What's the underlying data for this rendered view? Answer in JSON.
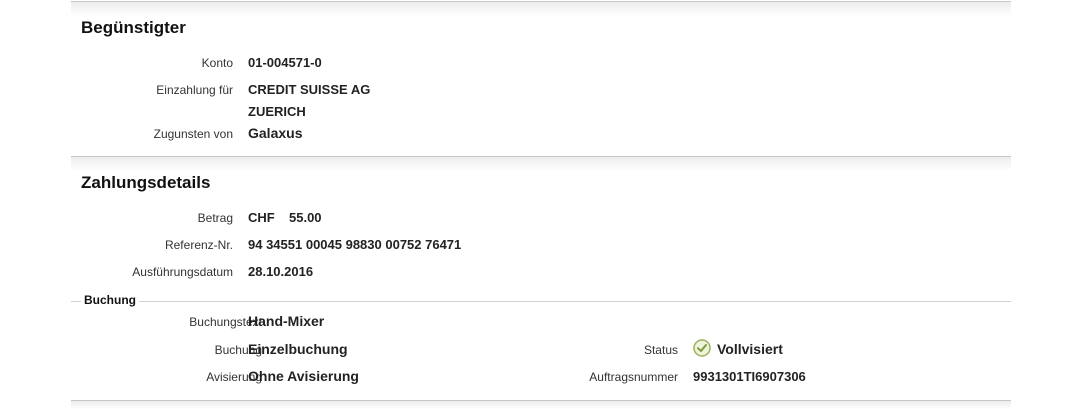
{
  "beneficiary": {
    "title": "Begünstigter",
    "konto_label": "Konto",
    "konto_value": "01-004571-0",
    "einzahlung_label": "Einzahlung für",
    "einzahlung_line1": "CREDIT SUISSE AG",
    "einzahlung_line2": "ZUERICH",
    "zugunsten_label": "Zugunsten von",
    "zugunsten_value": "Galaxus"
  },
  "payment": {
    "title": "Zahlungsdetails",
    "betrag_label": "Betrag",
    "currency": "CHF",
    "amount": "55.00",
    "referenz_label": "Referenz-Nr.",
    "referenz_value": "94 34551 00045 98830 00752 76471",
    "datum_label": "Ausführungsdatum",
    "datum_value": "28.10.2016"
  },
  "booking": {
    "legend": "Buchung",
    "buchungstext_label": "Buchungstext",
    "buchungstext_value": "Hand-Mixer",
    "buchung_label": "Buchung",
    "buchung_value": "Einzelbuchung",
    "avisierung_label": "Avisierung",
    "avisierung_value": "Ohne Avisierung",
    "status_label": "Status",
    "status_value": "Vollvisiert",
    "status_icon": "check-circle-icon",
    "status_color": "#9ab35a",
    "auftrag_label": "Auftragsnummer",
    "auftrag_value": "9931301TI6907306"
  }
}
